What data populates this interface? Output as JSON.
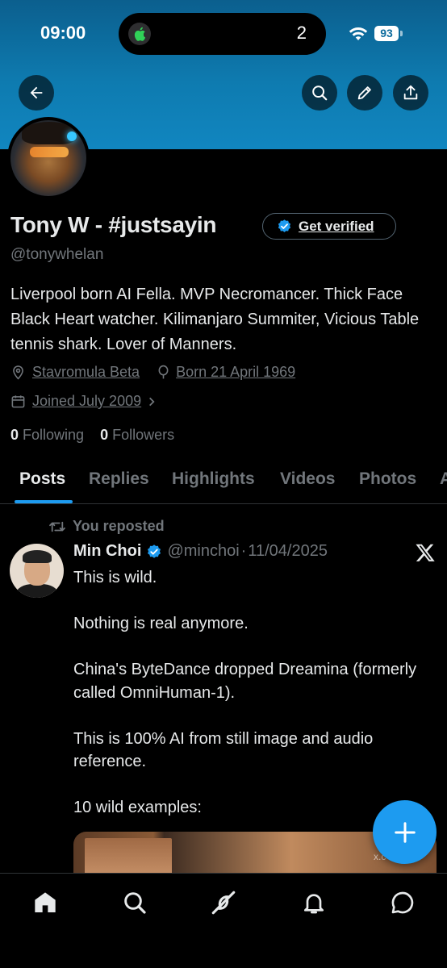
{
  "status_bar": {
    "time": "09:00",
    "island_count": "2",
    "battery": "93"
  },
  "header": {
    "back_icon": "arrow-left-icon",
    "search_icon": "search-icon",
    "edit_icon": "pencil-icon",
    "share_icon": "share-icon",
    "banner_color": "#0e7bb0"
  },
  "profile": {
    "name": "Tony W - #justsayin",
    "verify_button": "Get verified",
    "handle": "@tonywhelan",
    "bio": "Liverpool born AI Fella. MVP Necromancer. Thick Face Black Heart watcher. Kilimanjaro Summiter, Vicious Table tennis shark. Lover of Manners.",
    "location": "Stavromula Beta",
    "birthday": "Born 21 April 1969",
    "joined": "Joined July 2009",
    "following_count": "0",
    "following_label": "Following",
    "followers_count": "0",
    "followers_label": "Followers"
  },
  "tabs": [
    {
      "label": "Posts",
      "active": true
    },
    {
      "label": "Replies"
    },
    {
      "label": "Highlights"
    },
    {
      "label": "Videos"
    },
    {
      "label": "Photos"
    },
    {
      "label": "A"
    }
  ],
  "post": {
    "repost_label": "You reposted",
    "author": "Min Choi",
    "handle": "@minchoi",
    "separator": "·",
    "date": "11/04/2025",
    "text": "This is wild.\n\nNothing is real anymore.\n\nChina's ByteDance dropped Dreamina (formerly called OmniHuman-1).\n\nThis is 100% AI from still image and audio reference.\n\n10 wild examples:",
    "media_watermark": "x.c"
  },
  "fab": {
    "icon": "plus-icon"
  },
  "bottom_nav": [
    {
      "icon": "home-icon"
    },
    {
      "icon": "search-icon"
    },
    {
      "icon": "grok-icon"
    },
    {
      "icon": "bell-icon"
    },
    {
      "icon": "messages-icon"
    }
  ],
  "colors": {
    "accent": "#1d9bf0",
    "muted": "#71767b",
    "text": "#e7e9ea",
    "background": "#000000"
  }
}
